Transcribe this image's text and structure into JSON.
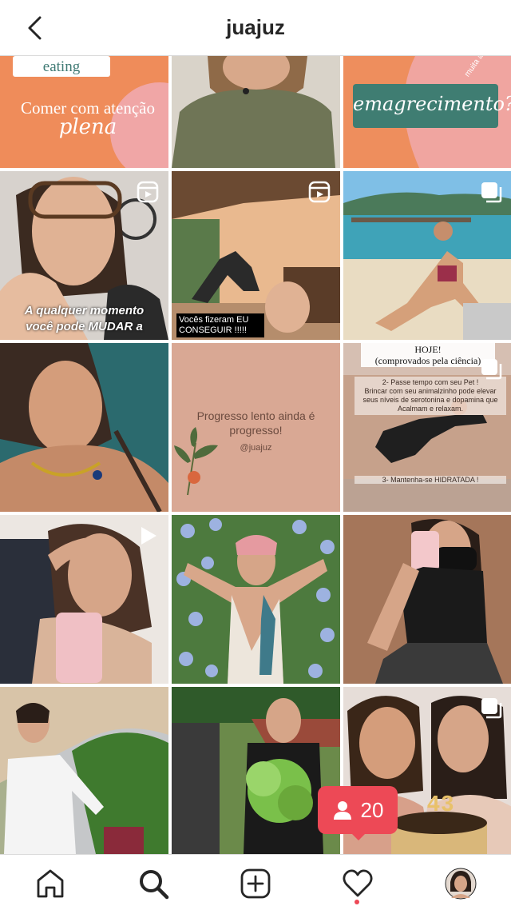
{
  "header": {
    "username": "juajuz"
  },
  "posts": {
    "p1": {
      "tag": "eating",
      "line1": "Comer com atenção",
      "line2": "plena"
    },
    "p3": {
      "text": "emagrecimento?",
      "arc": "muita atenção ganha"
    },
    "p4": {
      "caption1": "A qualquer momento",
      "caption2": "você pode MUDAR a"
    },
    "p5": {
      "caption1": "Vocês fizeram EU",
      "caption2": "CONSEGUIR !!!!!"
    },
    "p8": {
      "quote1": "Progresso lento ainda é",
      "quote2": "progresso!",
      "handle": "@juajuz"
    },
    "p9": {
      "title1": "HOJE!",
      "title2": "(comprovados pela ciência)",
      "tip1a": "2- Passe tempo com seu Pet !",
      "tip1b": "Brincar com seu animalzinho pode elevar",
      "tip1c": "seus níveis de serotonina e dopamina que",
      "tip1d": "Acalmam e relaxam.",
      "tip2": "3- Mantenha-se HIDRATADA !"
    },
    "p15": {
      "cake": "43"
    }
  },
  "notification": {
    "followers": "20"
  },
  "colors": {
    "accent": "#ed4956",
    "border": "#dbdbdb",
    "text": "#262626"
  }
}
